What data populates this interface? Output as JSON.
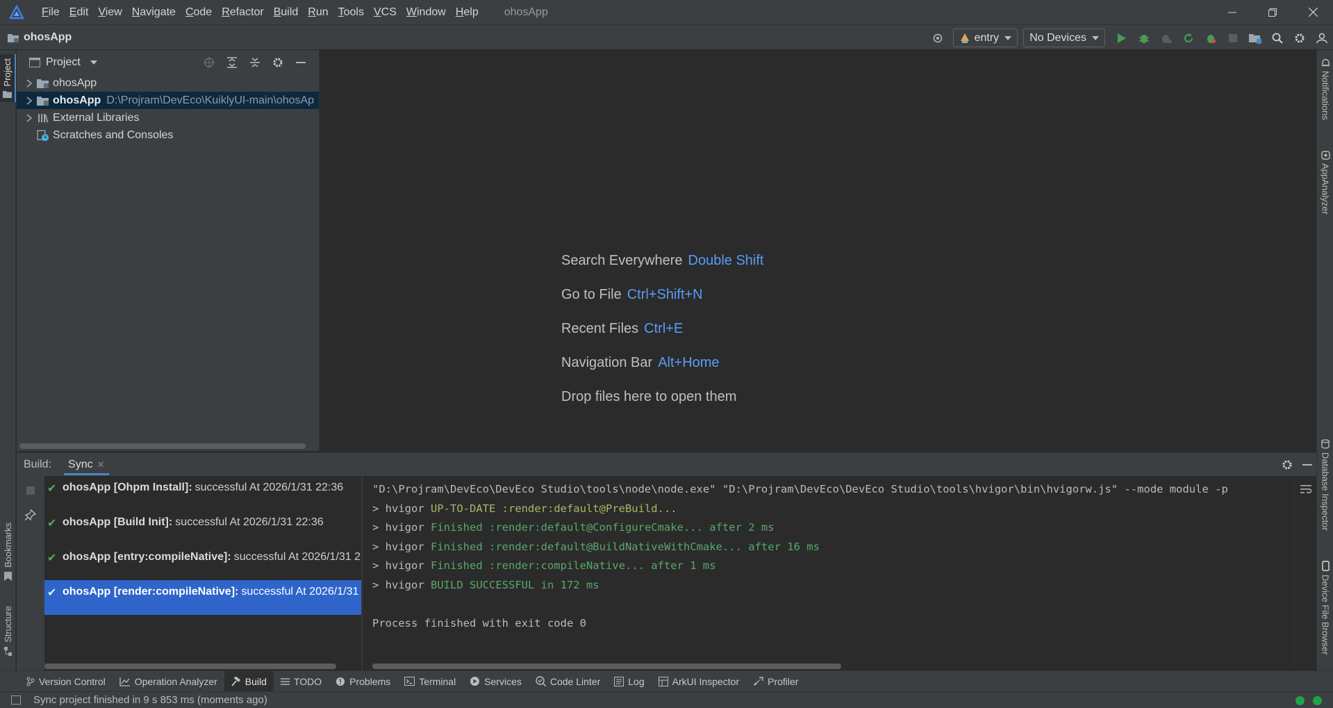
{
  "titlebar": {
    "menu": [
      {
        "u": "F",
        "rest": "ile"
      },
      {
        "u": "E",
        "rest": "dit"
      },
      {
        "u": "V",
        "rest": "iew"
      },
      {
        "u": "N",
        "rest": "avigate"
      },
      {
        "u": "C",
        "rest": "ode"
      },
      {
        "u": "R",
        "rest": "efactor"
      },
      {
        "u": "B",
        "rest": "uild"
      },
      {
        "u": "R",
        "rest": "un"
      },
      {
        "u": "T",
        "rest": "ools"
      },
      {
        "u": "V",
        "rest": "CS"
      },
      {
        "u": "W",
        "rest": "indow"
      },
      {
        "u": "H",
        "rest": "elp"
      }
    ],
    "window_title": "ohosApp"
  },
  "navbar": {
    "breadcrumb": "ohosApp",
    "run_config": "entry",
    "device": "No Devices"
  },
  "left_stripe": {
    "project_tab": "Project",
    "bookmarks_tab": "Bookmarks",
    "structure_tab": "Structure"
  },
  "right_stripe": {
    "notifications_tab": "Notifications",
    "appanalyzer_tab": "AppAnalyzer",
    "database_tab": "Database Inspector",
    "device_file_tab": "Device File Browser"
  },
  "project_panel": {
    "title": "Project",
    "tree": [
      {
        "label": "ohosApp",
        "path": ""
      },
      {
        "label": "ohosApp",
        "path": "D:\\Projram\\DevEco\\KuiklyUI-main\\ohosAp"
      },
      {
        "label": "External Libraries",
        "path": ""
      },
      {
        "label": "Scratches and Consoles",
        "path": ""
      }
    ]
  },
  "editor": {
    "hints": [
      {
        "label": "Search Everywhere",
        "shortcut": "Double Shift"
      },
      {
        "label": "Go to File",
        "shortcut": "Ctrl+Shift+N"
      },
      {
        "label": "Recent Files",
        "shortcut": "Ctrl+E"
      },
      {
        "label": "Navigation Bar",
        "shortcut": "Alt+Home"
      },
      {
        "label": "Drop files here to open them",
        "shortcut": ""
      }
    ]
  },
  "build_panel": {
    "label": "Build:",
    "tab": "Sync",
    "tasks": [
      {
        "name": "ohosApp [Ohpm Install]:",
        "status": "successful At 2026/1/31 22:36"
      },
      {
        "name": "ohosApp [Build Init]:",
        "status": "successful At 2026/1/31 22:36"
      },
      {
        "name": "ohosApp [entry:compileNative]:",
        "status": "successful At 2026/1/31 2"
      },
      {
        "name": "ohosApp [render:compileNative]:",
        "status": "successful At 2026/1/31"
      }
    ],
    "console": [
      {
        "prefix": "\"D:\\Projram\\DevEco\\DevEco Studio\\tools\\node\\node.exe\" \"D:\\Projram\\DevEco\\DevEco Studio\\tools\\hvigor\\bin\\hvigorw.js\" --mode module -p",
        "main": "",
        "tail": ""
      },
      {
        "prefix": "> hvigor ",
        "main": "UP-TO-DATE",
        "tail": " :render:default@PreBuild..."
      },
      {
        "prefix": "> hvigor ",
        "main": "Finished :render:default@ConfigureCmake... after 2 ms",
        "tail": ""
      },
      {
        "prefix": "> hvigor ",
        "main": "Finished :render:default@BuildNativeWithCmake... after 16 ms",
        "tail": ""
      },
      {
        "prefix": "> hvigor ",
        "main": "Finished :render:compileNative... after 1 ms",
        "tail": ""
      },
      {
        "prefix": "> hvigor ",
        "main": "BUILD SUCCESSFUL in 172 ms",
        "tail": ""
      },
      {
        "prefix": "",
        "main": "",
        "tail": ""
      },
      {
        "prefix": "Process finished with exit code 0",
        "main": "",
        "tail": ""
      }
    ]
  },
  "bottom_tabs": [
    {
      "label": "Version Control",
      "icon": "version-control-icon"
    },
    {
      "label": "Operation Analyzer",
      "icon": "chart-icon"
    },
    {
      "label": "Build",
      "icon": "hammer-icon"
    },
    {
      "label": "TODO",
      "icon": "list-icon"
    },
    {
      "label": "Problems",
      "icon": "info-icon"
    },
    {
      "label": "Terminal",
      "icon": "terminal-icon"
    },
    {
      "label": "Services",
      "icon": "services-icon"
    },
    {
      "label": "Code Linter",
      "icon": "linter-icon"
    },
    {
      "label": "Log",
      "icon": "log-icon"
    },
    {
      "label": "ArkUI Inspector",
      "icon": "inspector-icon"
    },
    {
      "label": "Profiler",
      "icon": "profiler-icon"
    }
  ],
  "status_bar": {
    "message": "Sync project finished in 9 s 853 ms (moments ago)"
  },
  "colors": {
    "accent": "#4a88c7",
    "success": "#59a869",
    "shortcut": "#589df6",
    "selection": "#2f65ca"
  }
}
